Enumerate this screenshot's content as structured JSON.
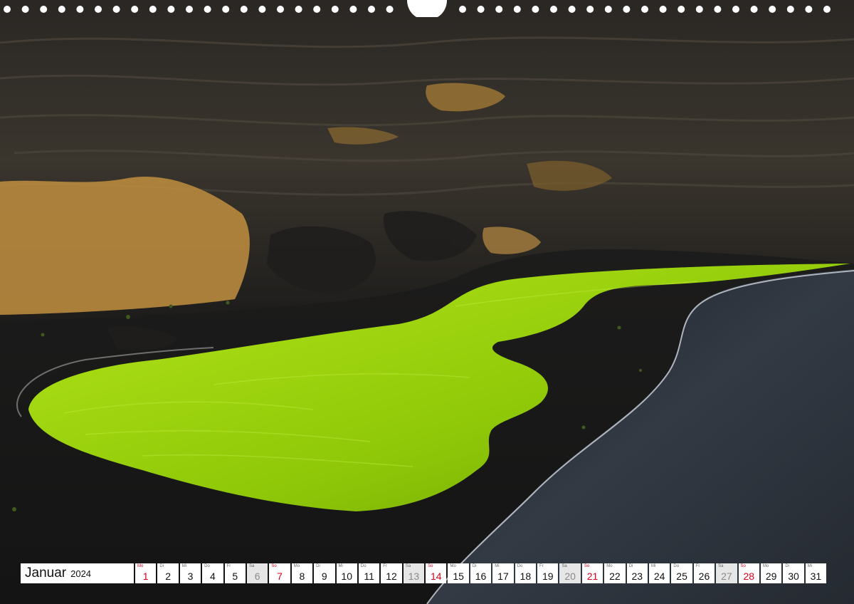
{
  "calendar": {
    "month": "Januar",
    "year": "2024",
    "days": [
      {
        "abbr": "Mo",
        "num": "1",
        "type": "holiday"
      },
      {
        "abbr": "Di",
        "num": "2",
        "type": "weekday"
      },
      {
        "abbr": "Mi",
        "num": "3",
        "type": "weekday"
      },
      {
        "abbr": "Do",
        "num": "4",
        "type": "weekday"
      },
      {
        "abbr": "Fr",
        "num": "5",
        "type": "weekday"
      },
      {
        "abbr": "Sa",
        "num": "6",
        "type": "saturday"
      },
      {
        "abbr": "So",
        "num": "7",
        "type": "sunday"
      },
      {
        "abbr": "Mo",
        "num": "8",
        "type": "weekday"
      },
      {
        "abbr": "Di",
        "num": "9",
        "type": "weekday"
      },
      {
        "abbr": "Mi",
        "num": "10",
        "type": "weekday"
      },
      {
        "abbr": "Do",
        "num": "11",
        "type": "weekday"
      },
      {
        "abbr": "Fr",
        "num": "12",
        "type": "weekday"
      },
      {
        "abbr": "Sa",
        "num": "13",
        "type": "saturday"
      },
      {
        "abbr": "So",
        "num": "14",
        "type": "sunday"
      },
      {
        "abbr": "Mo",
        "num": "15",
        "type": "weekday"
      },
      {
        "abbr": "Di",
        "num": "16",
        "type": "weekday"
      },
      {
        "abbr": "Mi",
        "num": "17",
        "type": "weekday"
      },
      {
        "abbr": "Do",
        "num": "18",
        "type": "weekday"
      },
      {
        "abbr": "Fr",
        "num": "19",
        "type": "weekday"
      },
      {
        "abbr": "Sa",
        "num": "20",
        "type": "saturday"
      },
      {
        "abbr": "So",
        "num": "21",
        "type": "sunday"
      },
      {
        "abbr": "Mo",
        "num": "22",
        "type": "weekday"
      },
      {
        "abbr": "Di",
        "num": "23",
        "type": "weekday"
      },
      {
        "abbr": "Mi",
        "num": "24",
        "type": "weekday"
      },
      {
        "abbr": "Do",
        "num": "25",
        "type": "weekday"
      },
      {
        "abbr": "Fr",
        "num": "26",
        "type": "weekday"
      },
      {
        "abbr": "Sa",
        "num": "27",
        "type": "saturday"
      },
      {
        "abbr": "So",
        "num": "28",
        "type": "sunday"
      },
      {
        "abbr": "Mo",
        "num": "29",
        "type": "weekday"
      },
      {
        "abbr": "Di",
        "num": "30",
        "type": "weekday"
      },
      {
        "abbr": "Mi",
        "num": "31",
        "type": "weekday"
      }
    ]
  },
  "colors": {
    "lagoon": "#9ccf0a",
    "sand": "#1b1b1d",
    "cliff": "#3a3630",
    "cliff_ochre": "#b88a3e",
    "ocean": "#2b3038",
    "holiday_red": "#d9001b"
  }
}
